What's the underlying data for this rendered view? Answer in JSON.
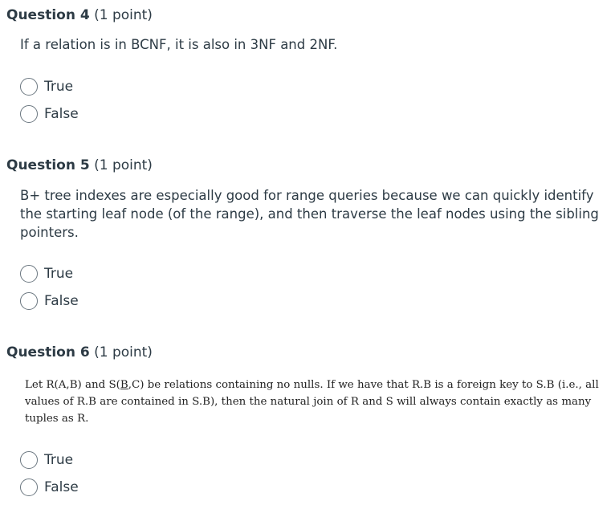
{
  "questions": [
    {
      "title": "Question 4",
      "points": "(1 point)",
      "text": "If a relation is in BCNF, it is also in 3NF and 2NF.",
      "options": [
        "True",
        "False"
      ]
    },
    {
      "title": "Question 5",
      "points": "(1 point)",
      "text": "B+ tree indexes are especially good for range queries because we can quickly identify the starting leaf node (of the range), and then traverse the leaf nodes using the sibling pointers.",
      "options": [
        "True",
        "False"
      ]
    },
    {
      "title": "Question 6",
      "points": "(1 point)",
      "text_parts": {
        "a": "Let R(A,B) and S(",
        "b": "B",
        "c": ",C) be relations containing no nulls. If we have that R.B is a foreign key to S.B (i.e., all values of R.B are contained in S.B), then the natural join of R and S will always contain exactly as many tuples as R."
      },
      "options": [
        "True",
        "False"
      ]
    }
  ]
}
